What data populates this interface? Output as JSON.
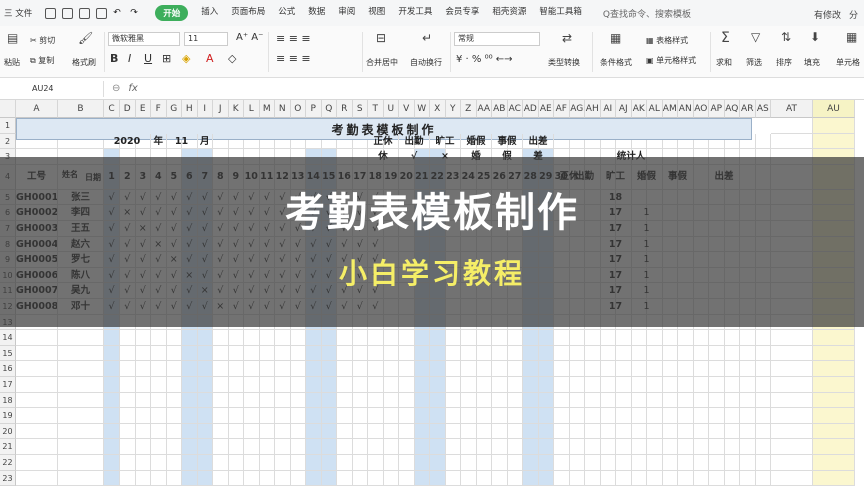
{
  "menubar": {
    "file": "三 文件",
    "tabs": [
      "开始",
      "插入",
      "页面布局",
      "公式",
      "数据",
      "审阅",
      "视图",
      "开发工具",
      "会员专享",
      "稻壳资源",
      "智能工具箱"
    ],
    "active_tab": "开始",
    "search": "Q查找命令、搜索模板",
    "status": "有修改",
    "share": "分"
  },
  "ribbon": {
    "paste": "粘贴",
    "cut": "剪切",
    "copy": "复制",
    "format_painter": "格式刷",
    "font_name": "微软雅黑",
    "font_size": "11",
    "merge": "合并居中",
    "wrap": "自动换行",
    "number_format": "常规",
    "type_convert": "类型转换",
    "cond_format": "条件格式",
    "table_style": "表格样式",
    "cell_style": "单元格样式",
    "sum": "求和",
    "filter": "筛选",
    "sort": "排序",
    "fill": "填充",
    "cell": "单元格"
  },
  "formula_bar": {
    "name_box": "AU24",
    "fx": "fx"
  },
  "columns": [
    "A",
    "B",
    "C",
    "D",
    "E",
    "F",
    "G",
    "H",
    "I",
    "J",
    "K",
    "L",
    "M",
    "N",
    "O",
    "P",
    "Q",
    "R",
    "S",
    "T",
    "U",
    "V",
    "W",
    "X",
    "Y",
    "Z",
    "AA",
    "AB",
    "AC",
    "AD",
    "AE",
    "AF",
    "AG",
    "AH",
    "AI",
    "AJ",
    "AK",
    "AL",
    "AM",
    "AN",
    "AO",
    "AP",
    "AQ",
    "AR",
    "AS",
    "AT",
    "AU"
  ],
  "rows": [
    "1",
    "2",
    "3",
    "4",
    "5",
    "6",
    "7",
    "8",
    "9",
    "10",
    "11",
    "12",
    "13",
    "14",
    "15",
    "16",
    "17",
    "18",
    "19",
    "20",
    "21",
    "22",
    "23"
  ],
  "sheet": {
    "title": "考勤表模板制作",
    "year": "2020",
    "year_label": "年",
    "month": "11",
    "month_label": "月",
    "legend": [
      {
        "name": "正休",
        "symbol": "休"
      },
      {
        "name": "出勤",
        "symbol": "√"
      },
      {
        "name": "旷工",
        "symbol": "×"
      },
      {
        "name": "婚假",
        "symbol": "婚"
      },
      {
        "name": "事假",
        "symbol": "假"
      },
      {
        "name": "出差",
        "symbol": "差"
      }
    ],
    "stats_label": "统计人",
    "header_id": "工号",
    "header_date": "日期",
    "header_name": "姓名",
    "days": [
      "1",
      "2",
      "3",
      "4",
      "5",
      "6",
      "7",
      "8",
      "9",
      "10",
      "11",
      "12",
      "13",
      "14",
      "15",
      "16",
      "17",
      "18",
      "19",
      "20",
      "21",
      "22",
      "23",
      "24",
      "25",
      "26",
      "27",
      "28",
      "29",
      "30"
    ],
    "stat_headers": [
      "正休",
      "出勤",
      "旷工",
      "婚假",
      "事假",
      "出差"
    ],
    "employees": [
      {
        "id": "GH0001",
        "name": "张三",
        "marks": [
          "√",
          "√",
          "√",
          "√",
          "√",
          "√",
          "√",
          "√",
          "√",
          "√",
          "√",
          "√",
          "√",
          "√",
          "√",
          "√",
          "√",
          "√"
        ],
        "attendance": "18",
        "absent": ""
      },
      {
        "id": "GH0002",
        "name": "李四",
        "marks": [
          "√",
          "×",
          "√",
          "√",
          "√",
          "√",
          "√",
          "√",
          "√",
          "√",
          "√",
          "√",
          "√",
          "√",
          "√",
          "√",
          "√",
          "√"
        ],
        "attendance": "17",
        "absent": "1"
      },
      {
        "id": "GH0003",
        "name": "王五",
        "marks": [
          "√",
          "√",
          "×",
          "√",
          "√",
          "√",
          "√",
          "√",
          "√",
          "√",
          "√",
          "√",
          "√",
          "√",
          "√",
          "√",
          "√",
          "√"
        ],
        "attendance": "17",
        "absent": "1"
      },
      {
        "id": "GH0004",
        "name": "赵六",
        "marks": [
          "√",
          "√",
          "√",
          "×",
          "√",
          "√",
          "√",
          "√",
          "√",
          "√",
          "√",
          "√",
          "√",
          "√",
          "√",
          "√",
          "√",
          "√"
        ],
        "attendance": "17",
        "absent": "1"
      },
      {
        "id": "GH0005",
        "name": "罗七",
        "marks": [
          "√",
          "√",
          "√",
          "√",
          "×",
          "√",
          "√",
          "√",
          "√",
          "√",
          "√",
          "√",
          "√",
          "√",
          "√",
          "√",
          "√",
          "√"
        ],
        "attendance": "17",
        "absent": "1"
      },
      {
        "id": "GH0006",
        "name": "陈八",
        "marks": [
          "√",
          "√",
          "√",
          "√",
          "√",
          "×",
          "√",
          "√",
          "√",
          "√",
          "√",
          "√",
          "√",
          "√",
          "√",
          "√",
          "√",
          "√"
        ],
        "attendance": "17",
        "absent": "1"
      },
      {
        "id": "GH0007",
        "name": "吴九",
        "marks": [
          "√",
          "√",
          "√",
          "√",
          "√",
          "√",
          "×",
          "√",
          "√",
          "√",
          "√",
          "√",
          "√",
          "√",
          "√",
          "√",
          "√",
          "√"
        ],
        "attendance": "17",
        "absent": "1"
      },
      {
        "id": "GH0008",
        "name": "邓十",
        "marks": [
          "√",
          "√",
          "√",
          "√",
          "√",
          "√",
          "√",
          "×",
          "√",
          "√",
          "√",
          "√",
          "√",
          "√",
          "√",
          "√",
          "√",
          "√"
        ],
        "attendance": "17",
        "absent": "1"
      }
    ]
  },
  "overlay": {
    "title": "考勤表模板制作",
    "subtitle": "小白学习教程"
  },
  "colors": {
    "accent": "#3dae5c",
    "weekend_band": "#cfe1f3",
    "selected_column": "#fbf7cf",
    "subtitle": "#f5ee67"
  }
}
